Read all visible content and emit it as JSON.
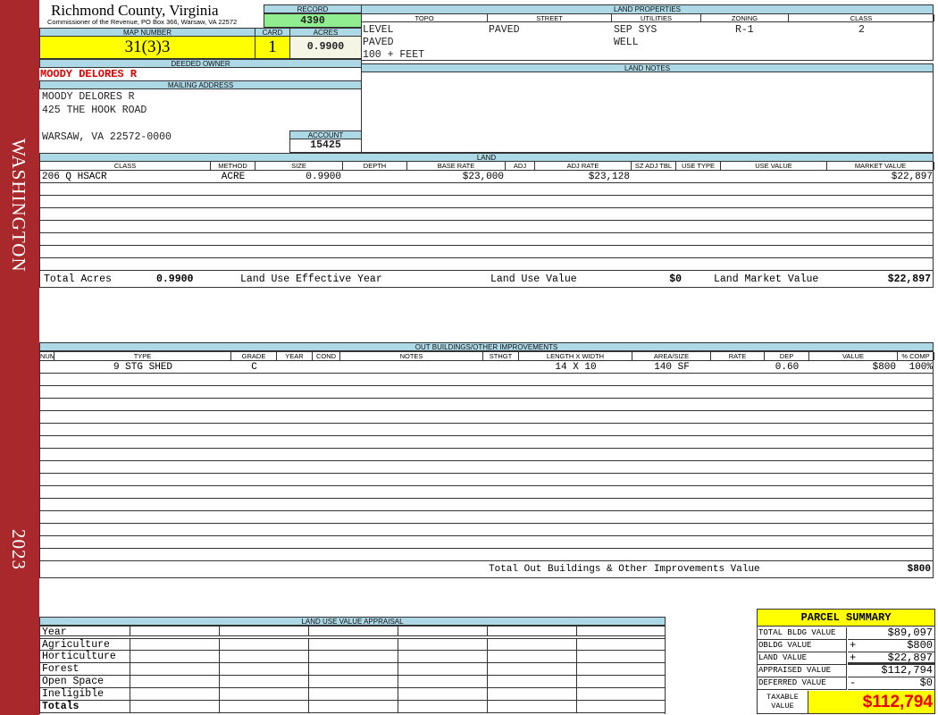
{
  "side": {
    "top": "WASHINGTON",
    "year": "2023"
  },
  "header": {
    "title": "Richmond County, Virginia",
    "subtitle": "Commissioner of the Revenue, PO Box 366, Warsaw, VA 22572"
  },
  "record": {
    "label": "RECORD",
    "value": "4390"
  },
  "map": {
    "label": "MAP NUMBER",
    "value": "31(3)3",
    "card_label": "CARD",
    "card": "1",
    "acres_label": "ACRES",
    "acres": "0.9900"
  },
  "owner": {
    "label": "DEEDED OWNER",
    "value": "MOODY DELORES R"
  },
  "mailing": {
    "label": "MAILING ADDRESS",
    "lines": [
      "MOODY DELORES R",
      "425 THE HOOK ROAD",
      "WARSAW, VA 22572-0000"
    ]
  },
  "account": {
    "label": "ACCOUNT",
    "value": "15425"
  },
  "land_properties": {
    "label": "LAND PROPERTIES",
    "columns": [
      "TOPO",
      "STREET",
      "UTILITIES",
      "ZONING",
      "CLASS"
    ],
    "topo": [
      "LEVEL",
      "PAVED",
      "100 + FEET"
    ],
    "street": "PAVED",
    "utilities": [
      "SEP SYS",
      "WELL"
    ],
    "zoning": "R-1",
    "class": "2"
  },
  "land_notes": {
    "label": "LAND NOTES"
  },
  "land": {
    "label": "LAND",
    "columns": [
      "CLASS",
      "METHOD",
      "SIZE",
      "DEPTH",
      "BASE RATE",
      "ADJ",
      "ADJ RATE",
      "SZ ADJ TBL",
      "USE TYPE",
      "USE VALUE",
      "MARKET VALUE"
    ],
    "rows": [
      [
        "206 Q HSACR",
        "ACRE",
        "0.9900",
        "",
        "$23,000",
        "",
        "$23,128",
        "",
        "",
        "",
        "$22,897"
      ]
    ],
    "totals": {
      "acres_label": "Total Acres",
      "acres": "0.9900",
      "year_label": "Land Use Effective Year",
      "use_label": "Land Use Value",
      "use_value": "$0",
      "market_label": "Land Market Value",
      "market_value": "$22,897"
    }
  },
  "outbuildings": {
    "label": "OUT BUILDINGS/OTHER IMPROVEMENTS",
    "columns": [
      "NUM",
      "TYPE",
      "GRADE",
      "YEAR",
      "COND",
      "NOTES",
      "STHGT",
      "LENGTH X WIDTH",
      "AREA/SIZE",
      "RATE",
      "DEP",
      "VALUE",
      "% COMP"
    ],
    "rows": [
      [
        "",
        "9 STG SHED",
        "C",
        "",
        "",
        "",
        "",
        "14 X 10",
        "140 SF",
        "",
        "0.60",
        "$800",
        "100%"
      ]
    ],
    "total_label": "Total Out Buildings & Other Improvements Value",
    "total_value": "$800"
  },
  "land_use": {
    "label": "LAND USE VALUE APPRAISAL",
    "rows": [
      "Year",
      "Agriculture",
      "Horticulture",
      "Forest",
      "Open Space",
      "Ineligible",
      "Totals"
    ]
  },
  "summary": {
    "title": "PARCEL SUMMARY",
    "rows": [
      {
        "label": "TOTAL BLDG VALUE",
        "op": "",
        "value": "$89,097"
      },
      {
        "label": "OBLDG VALUE",
        "op": "+",
        "value": "$800"
      },
      {
        "label": "LAND VALUE",
        "op": "+",
        "value": "$22,897"
      },
      {
        "label": "APPRAISED VALUE",
        "op": "",
        "value": "$112,794"
      },
      {
        "label": "DEFERRED VALUE",
        "op": "-",
        "value": "$0"
      }
    ],
    "taxable_label": "TAXABLE VALUE",
    "taxable_value": "$112,794"
  },
  "colors": {
    "sidebar": "#a8282b",
    "header": "#add8e6",
    "record": "#90ee90",
    "highlight": "#ffff00",
    "owner": "#dd0000"
  }
}
